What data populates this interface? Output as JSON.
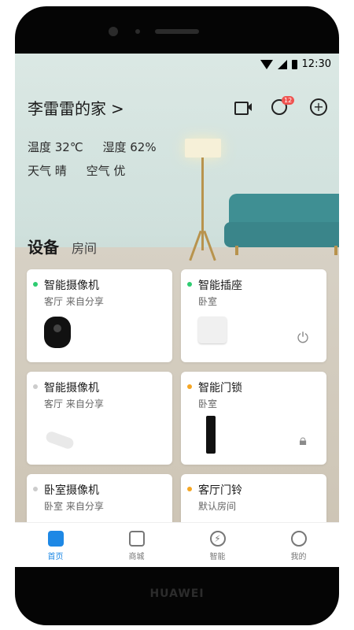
{
  "device_brand": "HUAWEI",
  "status_bar": {
    "time": "12:30"
  },
  "header": {
    "title": "李雷雷的家",
    "chevron": ">",
    "notification_badge": "12"
  },
  "environment": {
    "temperature": "温度 32℃",
    "humidity": "湿度 62%",
    "weather": "天气 晴",
    "air": "空气 优"
  },
  "tabs": {
    "active": "设备",
    "other": "房间"
  },
  "devices": [
    {
      "name": "智能摄像机",
      "sub": "客厅 来自分享",
      "status_color": "#2ecc71"
    },
    {
      "name": "智能插座",
      "sub": "卧室",
      "status_color": "#2ecc71"
    },
    {
      "name": "智能摄像机",
      "sub": "客厅 来自分享",
      "status_color": "#cccccc"
    },
    {
      "name": "智能门锁",
      "sub": "卧室",
      "status_color": "#f5a623"
    },
    {
      "name": "卧室摄像机",
      "sub": "卧室 来自分享",
      "status_color": "#cccccc"
    },
    {
      "name": "客厅门铃",
      "sub": "默认房间",
      "status_color": "#f5a623"
    }
  ],
  "bottom_nav": [
    {
      "label": "首页",
      "active": true
    },
    {
      "label": "商城",
      "active": false
    },
    {
      "label": "智能",
      "active": false
    },
    {
      "label": "我的",
      "active": false
    }
  ],
  "colors": {
    "accent": "#1e88e5",
    "badge": "#ef5350"
  }
}
